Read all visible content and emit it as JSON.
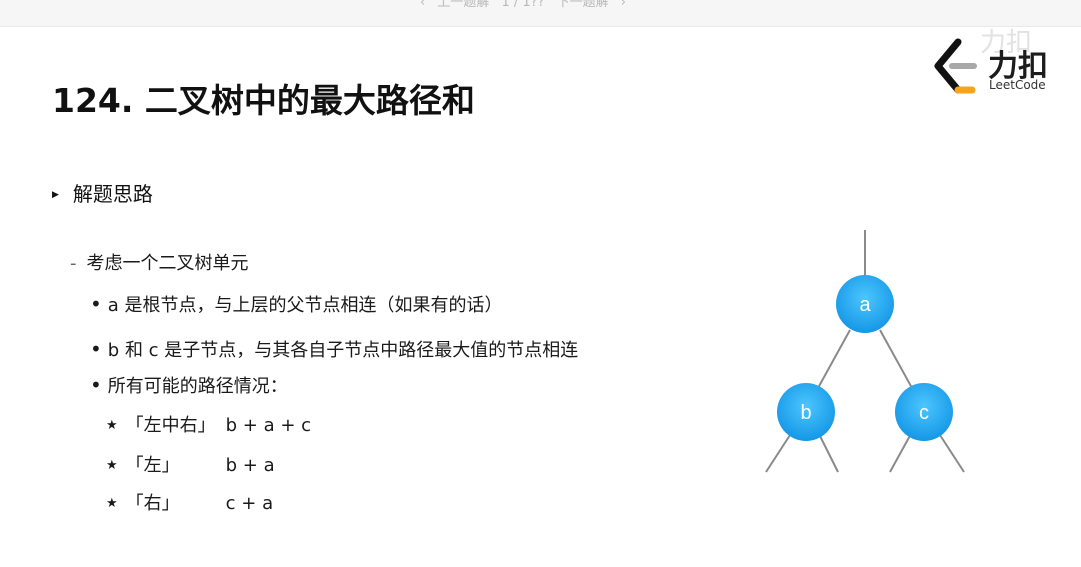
{
  "topbar": {
    "prev": "上一题解",
    "page": "1 / 1??",
    "next": "下一题解"
  },
  "watermark": "力扣",
  "logo": {
    "cn": "力扣",
    "en": "LeetCode"
  },
  "title": "124. 二叉树中的最大路径和",
  "section": "解题思路",
  "sub_heading": "考虑一个二叉树单元",
  "points": [
    "a 是根节点，与上层的父节点相连（如果有的话）",
    "b 和 c 是子节点，与其各自子节点中路径最大值的节点相连",
    "所有可能的路径情况："
  ],
  "paths": [
    {
      "label": "「左中右」",
      "expr": "b + a + c"
    },
    {
      "label": "「左」",
      "expr": "b + a"
    },
    {
      "label": "「右」",
      "expr": "c + a"
    }
  ],
  "tree": {
    "nodes": [
      "a",
      "b",
      "c"
    ],
    "node_color": "#1ea7ef"
  }
}
